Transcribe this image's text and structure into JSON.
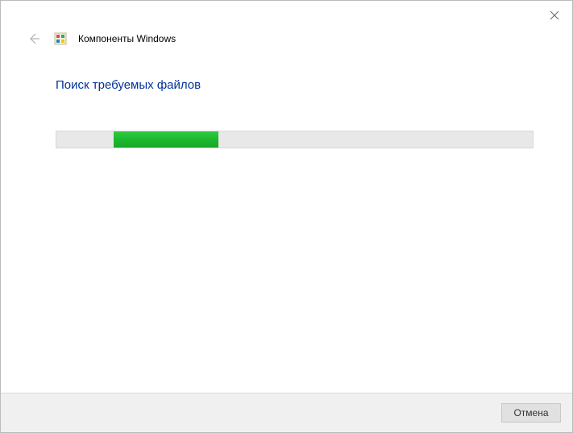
{
  "window": {
    "title": "Компоненты Windows"
  },
  "content": {
    "heading": "Поиск требуемых файлов"
  },
  "progress": {
    "segment_left_pct": 12,
    "segment_width_pct": 22,
    "color": "#1db82e"
  },
  "footer": {
    "cancel_label": "Отмена"
  }
}
